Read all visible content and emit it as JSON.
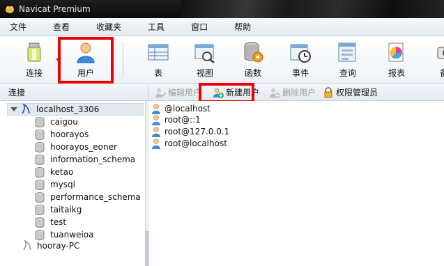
{
  "window": {
    "title": "Navicat Premium"
  },
  "menu": [
    "文件",
    "查看",
    "收藏夹",
    "工具",
    "窗口",
    "帮助"
  ],
  "toolbar": {
    "connect": "连接",
    "user": "用户",
    "table": "表",
    "view": "视图",
    "function": "函数",
    "event": "事件",
    "query": "查询",
    "report": "报表",
    "backup": "备"
  },
  "left_panel": {
    "header": "连接"
  },
  "sub_toolbar": {
    "edit_user": "编辑用户",
    "new_user": "新建用户",
    "delete_user": "删除用户",
    "privilege_manager": "权限管理员"
  },
  "tree": {
    "connection": "localhost_3306",
    "databases": [
      "caigou",
      "hoorayos",
      "hoorayos_eoner",
      "information_schema",
      "ketao",
      "mysql",
      "performance_schema",
      "taitaikg",
      "test",
      "tuanweioa"
    ],
    "other_connection": "hooray-PC"
  },
  "users": [
    "@localhost",
    "root@::1",
    "root@127.0.0.1",
    "root@localhost"
  ],
  "colors": {
    "highlight": "#ef0000",
    "titlebar": "#111111",
    "toolbar_bg": "#eef2f7"
  }
}
